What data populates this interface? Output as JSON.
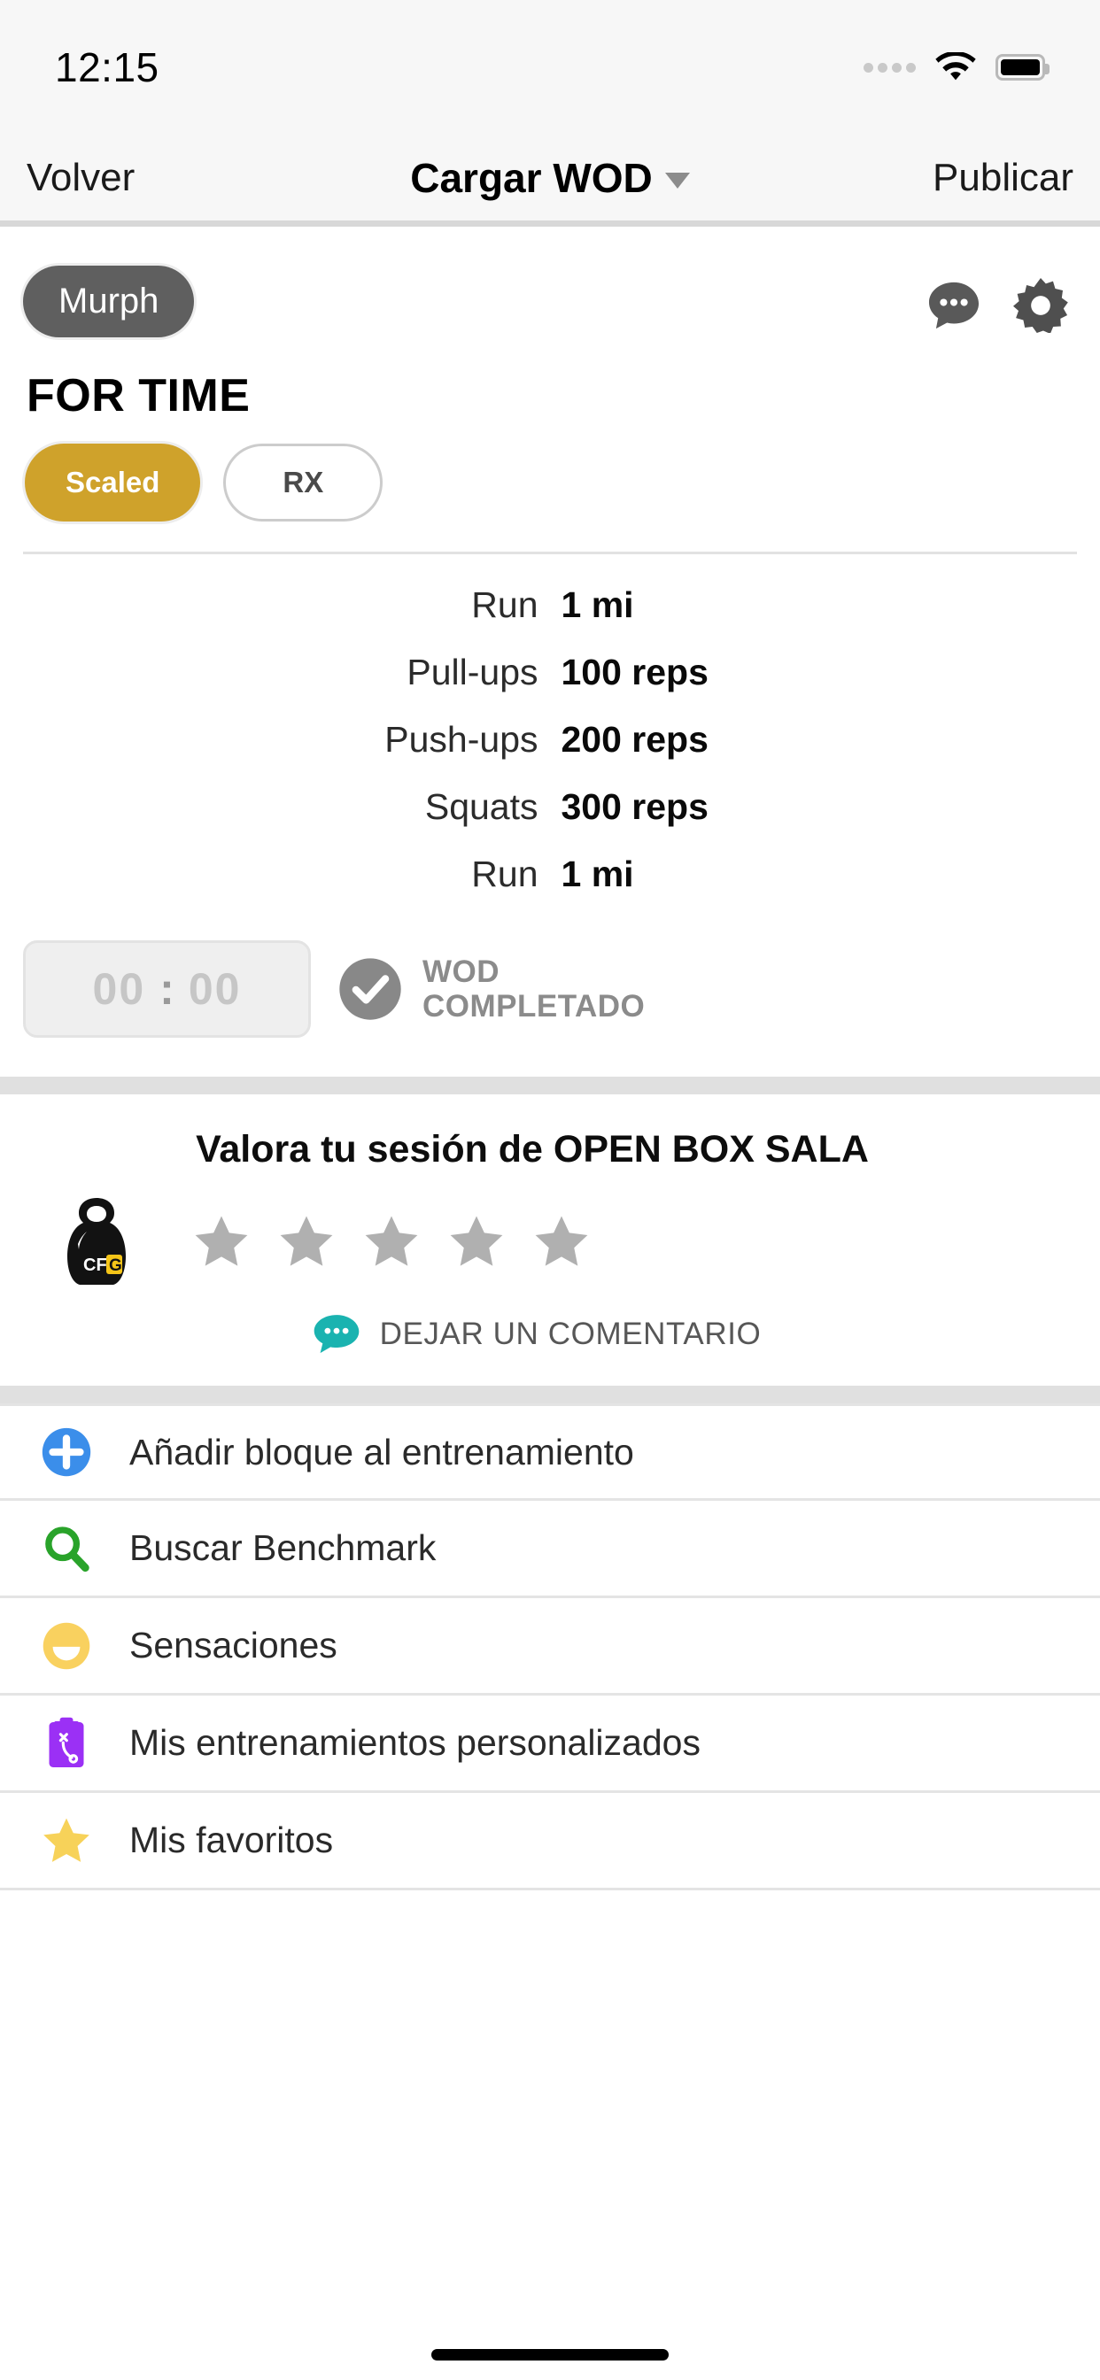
{
  "status_bar": {
    "time": "12:15",
    "signal_icon": "signal-dots-icon",
    "wifi_icon": "wifi-icon",
    "battery_icon": "battery-full-icon"
  },
  "nav": {
    "back_label": "Volver",
    "title": "Cargar WOD",
    "dropdown_icon": "chevron-down-icon",
    "publish_label": "Publicar"
  },
  "wod": {
    "name_chip": "Murph",
    "comment_icon": "comment-dots-icon",
    "settings_icon": "gear-icon",
    "type_title": "FOR TIME",
    "scale_options": [
      {
        "label": "Scaled",
        "selected": true
      },
      {
        "label": "RX",
        "selected": false
      }
    ],
    "movements": [
      {
        "name": "Run",
        "value": "1 mi"
      },
      {
        "name": "Pull-ups",
        "value": "100 reps"
      },
      {
        "name": "Push-ups",
        "value": "200 reps"
      },
      {
        "name": "Squats",
        "value": "300 reps"
      },
      {
        "name": "Run",
        "value": "1 mi"
      }
    ],
    "timer": {
      "minutes": "00",
      "separator": ":",
      "seconds": "00"
    },
    "completed": {
      "line1": "WOD",
      "line2": "COMPLETADO",
      "check_icon": "check-circle-icon"
    }
  },
  "rating": {
    "title": "Valora tu sesión de OPEN BOX SALA",
    "logo_icon": "kettlebell-cfg-logo",
    "logo_text_left": "CF",
    "logo_text_right": "G",
    "stars_total": 5,
    "stars_filled": 0,
    "comment_icon": "comment-bubble-icon",
    "comment_label": "DEJAR UN COMENTARIO"
  },
  "actions": [
    {
      "label": "Añadir bloque al entrenamiento",
      "icon": "plus-circle-icon",
      "color": "#3b8eea"
    },
    {
      "label": "Buscar Benchmark",
      "icon": "search-icon",
      "color": "#29a32a"
    },
    {
      "label": "Sensaciones",
      "icon": "smiley-icon",
      "color": "#f9d15f"
    },
    {
      "label": "Mis entrenamientos personalizados",
      "icon": "clipboard-playbook-icon",
      "color": "#9b30f5"
    },
    {
      "label": "Mis favoritos",
      "icon": "star-icon",
      "color": "#f7d259"
    }
  ],
  "colors": {
    "accent_gold": "#cfa22b",
    "chip_gray": "#5f5f5f",
    "teal": "#1ab3b0",
    "blue": "#3b8eea",
    "green": "#29a32a",
    "yellow": "#f9d15f",
    "purple": "#9b30f5",
    "star_gray": "#b0b0b0",
    "star_gold": "#f7d259"
  }
}
